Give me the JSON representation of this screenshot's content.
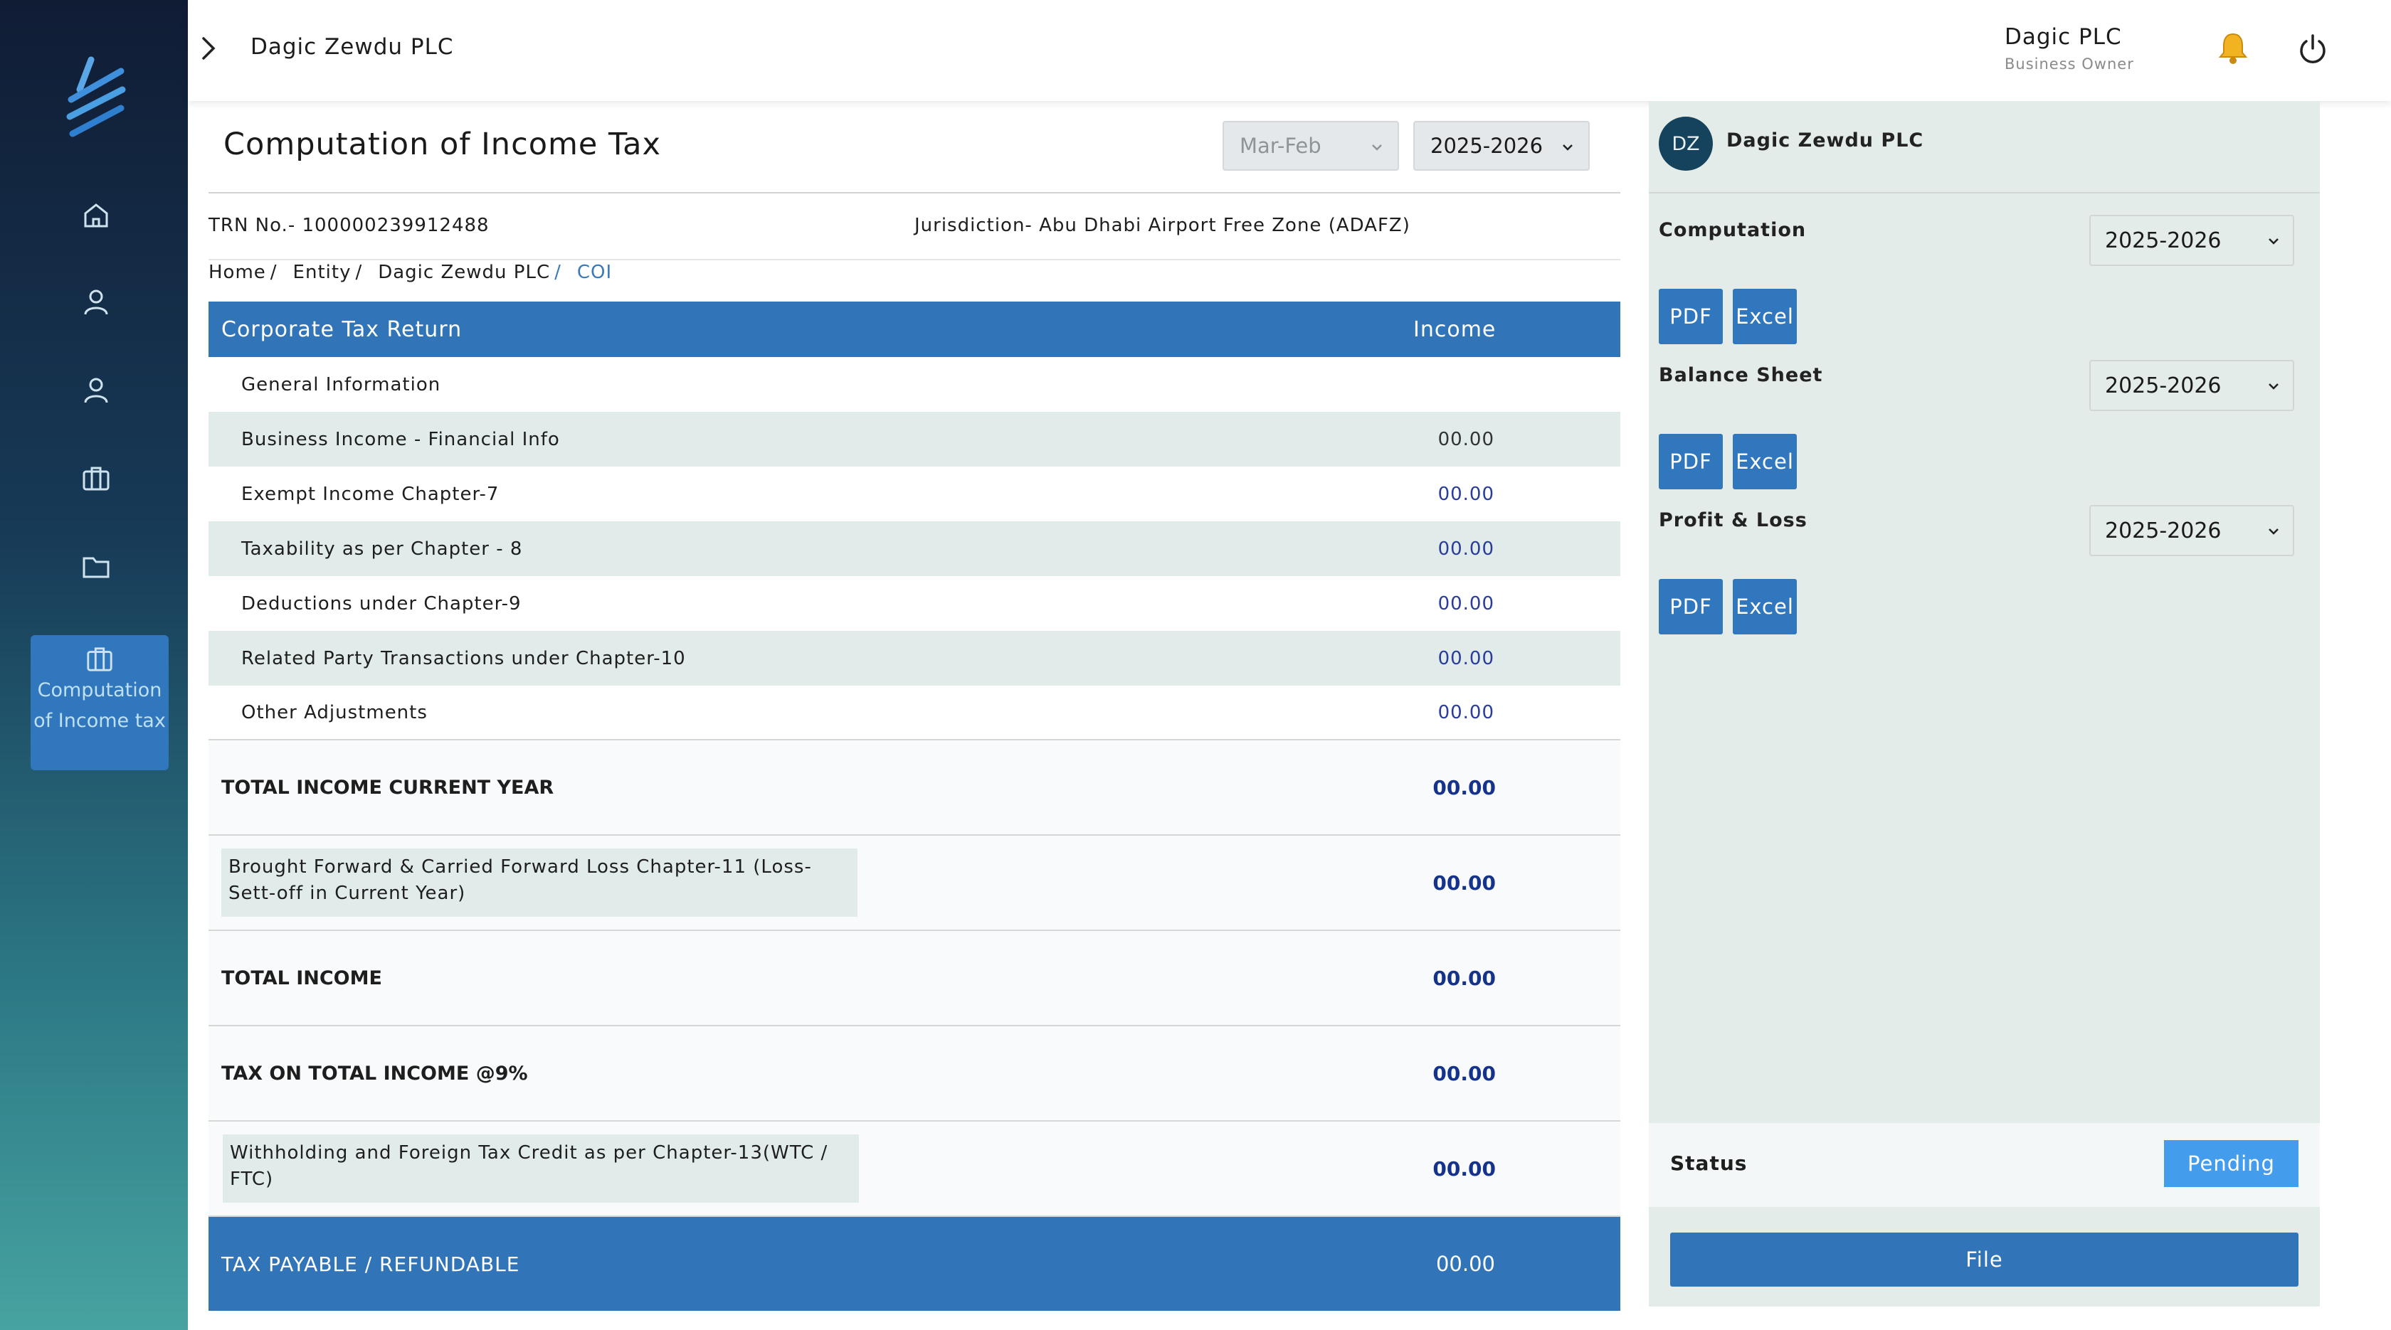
{
  "header": {
    "company": "Dagic Zewdu PLC",
    "user_name": "Dagic PLC",
    "user_role": "Business Owner"
  },
  "sidebar": {
    "active_label": "Computation of Income tax",
    "items": [
      "home-icon",
      "user-icon",
      "user-icon",
      "briefcase-icon",
      "folder-icon"
    ]
  },
  "main": {
    "title": "Computation of Income Tax",
    "period_select": "Mar-Feb",
    "year_select": "2025-2026",
    "trn": "TRN No.- 100000239912488",
    "jurisdiction": "Jurisdiction- Abu Dhabi Airport Free Zone (ADAFZ)",
    "breadcrumb": [
      "Home",
      "Entity",
      "Dagic Zewdu PLC",
      "COI"
    ]
  },
  "table": {
    "col1": "Corporate Tax Return",
    "col2": "Income",
    "rows": [
      {
        "label": "General Information",
        "value": ""
      },
      {
        "label": "Business Income - Financial Info",
        "value": "00.00"
      },
      {
        "label": "Exempt Income Chapter-7",
        "value": "00.00"
      },
      {
        "label": "Taxability as per Chapter - 8",
        "value": "00.00"
      },
      {
        "label": "Deductions under Chapter-9",
        "value": "00.00"
      },
      {
        "label": "Related Party Transactions under Chapter-10",
        "value": "00.00"
      },
      {
        "label": "Other Adjustments",
        "value": "00.00"
      }
    ],
    "total_current_year": {
      "label": "TOTAL INCOME CURRENT YEAR",
      "value": "00.00"
    },
    "brought_forward": {
      "label": "Brought Forward & Carried Forward Loss Chapter-11 (Loss- Sett-off in Current Year)",
      "value": "00.00"
    },
    "total_income": {
      "label": "TOTAL INCOME",
      "value": "00.00"
    },
    "tax_on_total": {
      "label": "TAX ON TOTAL INCOME @9%",
      "value": "00.00"
    },
    "withholding": {
      "label": "Withholding and Foreign Tax Credit as per Chapter-13(WTC / FTC)",
      "value": "00.00"
    },
    "payable": {
      "label": "TAX PAYABLE / REFUNDABLE",
      "value": "00.00"
    }
  },
  "panel": {
    "avatar": "DZ",
    "name": "Dagic Zewdu PLC",
    "sections": [
      {
        "label": "Computation",
        "year": "2025-2026",
        "pdf": "PDF",
        "excel": "Excel"
      },
      {
        "label": "Balance Sheet",
        "year": "2025-2026",
        "pdf": "PDF",
        "excel": "Excel"
      },
      {
        "label": "Profit & Loss",
        "year": "2025-2026",
        "pdf": "PDF",
        "excel": "Excel"
      }
    ],
    "status_label": "Status",
    "status_value": "Pending",
    "file_label": "File"
  }
}
